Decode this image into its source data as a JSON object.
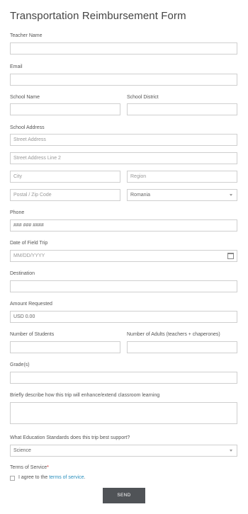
{
  "form": {
    "title": "Transportation Reimbursement Form",
    "teacher_name_label": "Teacher Name",
    "email_label": "Email",
    "school_name_label": "School Name",
    "school_district_label": "School District",
    "school_address_label": "School Address",
    "street_address_placeholder": "Street Address",
    "street_address2_placeholder": "Street Address Line 2",
    "city_placeholder": "City",
    "region_placeholder": "Region",
    "postal_placeholder": "Postal / Zip Code",
    "country_value": "Romania",
    "phone_label": "Phone",
    "phone_placeholder": "### ### ####",
    "field_trip_date_label": "Date of Field Trip",
    "date_placeholder": "MM/DD/YYYY",
    "destination_label": "Destination",
    "amount_label": "Amount Requested",
    "amount_value": "USD  0.00",
    "students_label": "Number of Students",
    "adults_label": "Number of Adults (teachers + chaperones)",
    "grades_label": "Grade(s)",
    "describe_label": "Briefly describe how this trip will enhance/extend classroom learning",
    "standards_label": "What Education Standards does this trip best support?",
    "standards_value": "Science",
    "terms_label": "Terms of Service",
    "terms_required_mark": "*",
    "agree_text": "I agree to the ",
    "terms_link": "terms of service",
    "terms_period": ".",
    "send_label": "SEND"
  }
}
